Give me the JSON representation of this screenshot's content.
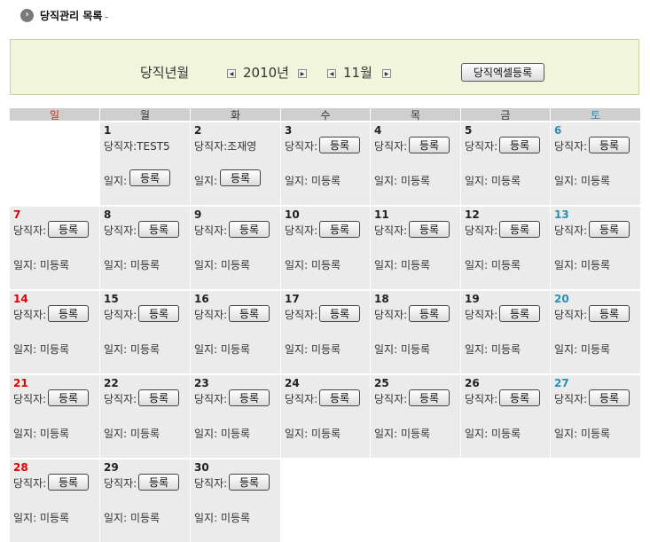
{
  "page": {
    "title": "당직관리 목록",
    "title_icon": "chevron-right-circle-icon"
  },
  "filter": {
    "label": "당직년월",
    "year": "2010년",
    "month": "11월",
    "prev_icon": "arrow-left-icon",
    "next_icon": "arrow-right-icon",
    "excel_button": "당직엑셀등록"
  },
  "calendar": {
    "weekdays": [
      "일",
      "월",
      "화",
      "수",
      "목",
      "금",
      "토"
    ],
    "duty_label": "당직자:",
    "diary_label": "일지:",
    "register_label": "등록",
    "unregistered": "미등록",
    "colors": {
      "sunday": "#e00000",
      "saturday": "#2f8fb0",
      "cell_bg": "#ebebeb",
      "header_bg": "#cfcfcf",
      "panel_bg": "#f0f5dc"
    },
    "days": [
      {
        "day": "1",
        "duty": "TEST5",
        "diary": ""
      },
      {
        "day": "2",
        "duty": "조재영",
        "diary": ""
      },
      {
        "day": "3",
        "duty": "",
        "diary": "미등록"
      },
      {
        "day": "4",
        "duty": "",
        "diary": "미등록"
      },
      {
        "day": "5",
        "duty": "",
        "diary": "미등록"
      },
      {
        "day": "6",
        "duty": "",
        "diary": "미등록"
      },
      {
        "day": "7",
        "duty": "",
        "diary": "미등록"
      },
      {
        "day": "8",
        "duty": "",
        "diary": "미등록"
      },
      {
        "day": "9",
        "duty": "",
        "diary": "미등록"
      },
      {
        "day": "10",
        "duty": "",
        "diary": "미등록"
      },
      {
        "day": "11",
        "duty": "",
        "diary": "미등록"
      },
      {
        "day": "12",
        "duty": "",
        "diary": "미등록"
      },
      {
        "day": "13",
        "duty": "",
        "diary": "미등록"
      },
      {
        "day": "14",
        "duty": "",
        "diary": "미등록"
      },
      {
        "day": "15",
        "duty": "",
        "diary": "미등록"
      },
      {
        "day": "16",
        "duty": "",
        "diary": "미등록"
      },
      {
        "day": "17",
        "duty": "",
        "diary": "미등록"
      },
      {
        "day": "18",
        "duty": "",
        "diary": "미등록"
      },
      {
        "day": "19",
        "duty": "",
        "diary": "미등록"
      },
      {
        "day": "20",
        "duty": "",
        "diary": "미등록"
      },
      {
        "day": "21",
        "duty": "",
        "diary": "미등록"
      },
      {
        "day": "22",
        "duty": "",
        "diary": "미등록"
      },
      {
        "day": "23",
        "duty": "",
        "diary": "미등록"
      },
      {
        "day": "24",
        "duty": "",
        "diary": "미등록"
      },
      {
        "day": "25",
        "duty": "",
        "diary": "미등록"
      },
      {
        "day": "26",
        "duty": "",
        "diary": "미등록"
      },
      {
        "day": "27",
        "duty": "",
        "diary": "미등록"
      },
      {
        "day": "28",
        "duty": "",
        "diary": "미등록"
      },
      {
        "day": "29",
        "duty": "",
        "diary": "미등록"
      },
      {
        "day": "30",
        "duty": "",
        "diary": "미등록"
      }
    ]
  }
}
